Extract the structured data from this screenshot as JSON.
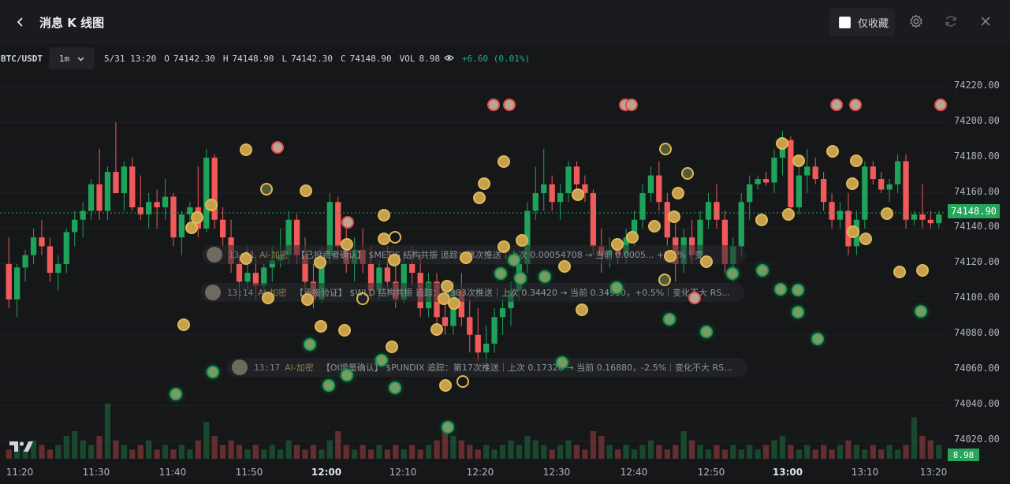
{
  "header": {
    "title": "消息 K 线图",
    "favorites_label": "仅收藏"
  },
  "ohlc": {
    "symbol": "BTC/USDT",
    "interval": "1m",
    "datetime": "5/31 13:20",
    "open_label": "O",
    "open": "74142.30",
    "high_label": "H",
    "high": "74148.90",
    "low_label": "L",
    "low": "74142.30",
    "close_label": "C",
    "close": "74148.90",
    "vol_label": "VOL",
    "vol": "8.98",
    "change": "+6.60 (0.01%)"
  },
  "price_axis": [
    "74220.00",
    "74200.00",
    "74180.00",
    "74160.00",
    "74140.00",
    "74120.00",
    "74100.00",
    "74080.00",
    "74060.00",
    "74040.00",
    "74020.00"
  ],
  "current_price": "74148.90",
  "current_volume": "8.98",
  "time_axis": [
    {
      "label": "11:20",
      "bold": false
    },
    {
      "label": "11:30",
      "bold": false
    },
    {
      "label": "11:40",
      "bold": false
    },
    {
      "label": "11:50",
      "bold": false
    },
    {
      "label": "12:00",
      "bold": true
    },
    {
      "label": "12:10",
      "bold": false
    },
    {
      "label": "12:20",
      "bold": false
    },
    {
      "label": "12:30",
      "bold": false
    },
    {
      "label": "12:40",
      "bold": false
    },
    {
      "label": "12:50",
      "bold": false
    },
    {
      "label": "13:00",
      "bold": true
    },
    {
      "label": "13:10",
      "bold": false
    },
    {
      "label": "13:20",
      "bold": false
    }
  ],
  "messages": [
    {
      "time": "13:11",
      "tag": "AI-加密",
      "text": "【已投资者确认】 $METIS 结构共振 追踪：第次推送｜上次 0.00054708 → 当前 0.0005... +2.1%｜变..."
    },
    {
      "time": "13:14",
      "tag": "AI-加密",
      "text": "【承接验证】 $WLD 结构共振 追踪：第383次推送｜上次 0.34420 → 当前 0.34930，+0.5%｜变化不大 RS..."
    },
    {
      "time": "13:17",
      "tag": "AI-加密",
      "text": "【OI增量确认】 $PUNDIX 追踪：第17次推送｜上次 0.17320 → 当前 0.16880，-2.5%｜变化不大 RS..."
    }
  ],
  "chart_data": {
    "type": "candlestick",
    "symbol": "BTC/USDT",
    "interval": "1m",
    "ylim": [
      74010,
      74225
    ],
    "x_start": "11:19",
    "x_end": "13:20",
    "candles": [
      [
        74120,
        74135,
        74095,
        74100
      ],
      [
        74100,
        74120,
        74090,
        74118
      ],
      [
        74118,
        74128,
        74110,
        74125
      ],
      [
        74125,
        74140,
        74120,
        74135
      ],
      [
        74135,
        74145,
        74125,
        74130
      ],
      [
        74130,
        74135,
        74110,
        74115
      ],
      [
        74115,
        74125,
        74105,
        74120
      ],
      [
        74120,
        74140,
        74115,
        74138
      ],
      [
        74138,
        74150,
        74130,
        74145
      ],
      [
        74145,
        74155,
        74135,
        74150
      ],
      [
        74150,
        74168,
        74145,
        74165
      ],
      [
        74165,
        74185,
        74145,
        74150
      ],
      [
        74150,
        74175,
        74145,
        74172
      ],
      [
        74172,
        74200,
        74160,
        74160
      ],
      [
        74160,
        74178,
        74150,
        74175
      ],
      [
        74175,
        74180,
        74150,
        74152
      ],
      [
        74152,
        74170,
        74145,
        74148
      ],
      [
        74148,
        74160,
        74140,
        74155
      ],
      [
        74155,
        74162,
        74140,
        74152
      ],
      [
        74152,
        74168,
        74145,
        74158
      ],
      [
        74158,
        74160,
        74130,
        74135
      ],
      [
        74135,
        74150,
        74125,
        74148
      ],
      [
        74148,
        74155,
        74140,
        74152
      ],
      [
        74152,
        74175,
        74135,
        74140
      ],
      [
        74140,
        74185,
        74138,
        74180
      ],
      [
        74180,
        74182,
        74140,
        74145
      ],
      [
        74145,
        74152,
        74130,
        74135
      ],
      [
        74135,
        74145,
        74115,
        74120
      ],
      [
        74120,
        74125,
        74100,
        74110
      ],
      [
        74110,
        74130,
        74105,
        74115
      ],
      [
        74115,
        74125,
        74100,
        74108
      ],
      [
        74108,
        74120,
        74102,
        74118
      ],
      [
        74118,
        74130,
        74110,
        74122
      ],
      [
        74122,
        74140,
        74118,
        74125
      ],
      [
        74125,
        74150,
        74120,
        74145
      ],
      [
        74145,
        74148,
        74120,
        74125
      ],
      [
        74125,
        74135,
        74105,
        74110
      ],
      [
        74110,
        74120,
        74095,
        74100
      ],
      [
        74100,
        74130,
        74098,
        74125
      ],
      [
        74125,
        74160,
        74120,
        74155
      ],
      [
        74155,
        74158,
        74125,
        74130
      ],
      [
        74130,
        74140,
        74115,
        74120
      ],
      [
        74120,
        74135,
        74110,
        74128
      ],
      [
        74128,
        74140,
        74115,
        74120
      ],
      [
        74120,
        74130,
        74100,
        74105
      ],
      [
        74105,
        74122,
        74100,
        74118
      ],
      [
        74118,
        74130,
        74105,
        74110
      ],
      [
        74110,
        74120,
        74095,
        74100
      ],
      [
        74100,
        74125,
        74098,
        74120
      ],
      [
        74120,
        74130,
        74108,
        74115
      ],
      [
        74115,
        74125,
        74090,
        74095
      ],
      [
        74095,
        74115,
        74090,
        74110
      ],
      [
        74110,
        74115,
        74085,
        74090
      ],
      [
        74090,
        74100,
        74080,
        74085
      ],
      [
        74085,
        74110,
        74080,
        74105
      ],
      [
        74105,
        74115,
        74085,
        74090
      ],
      [
        74090,
        74100,
        74070,
        74080
      ],
      [
        74080,
        74095,
        74065,
        74070
      ],
      [
        74070,
        74085,
        74060,
        74075
      ],
      [
        74075,
        74095,
        74070,
        74090
      ],
      [
        74090,
        74100,
        74080,
        74095
      ],
      [
        74095,
        74110,
        74085,
        74105
      ],
      [
        74105,
        74125,
        74100,
        74120
      ],
      [
        74120,
        74155,
        74115,
        74150
      ],
      [
        74150,
        74175,
        74145,
        74160
      ],
      [
        74160,
        74185,
        74150,
        74165
      ],
      [
        74165,
        74170,
        74150,
        74155
      ],
      [
        74155,
        74165,
        74145,
        74160
      ],
      [
        74160,
        74178,
        74155,
        74175
      ],
      [
        74175,
        74178,
        74160,
        74165
      ],
      [
        74165,
        74170,
        74155,
        74160
      ],
      [
        74160,
        74162,
        74125,
        74130
      ],
      [
        74130,
        74140,
        74115,
        74125
      ],
      [
        74125,
        74135,
        74118,
        74128
      ],
      [
        74128,
        74132,
        74120,
        74125
      ],
      [
        74125,
        74140,
        74120,
        74135
      ],
      [
        74135,
        74150,
        74130,
        74145
      ],
      [
        74145,
        74165,
        74140,
        74160
      ],
      [
        74160,
        74175,
        74155,
        74170
      ],
      [
        74170,
        74178,
        74150,
        74155
      ],
      [
        74155,
        74160,
        74130,
        74135
      ],
      [
        74135,
        74145,
        74110,
        74120
      ],
      [
        74120,
        74140,
        74115,
        74135
      ],
      [
        74135,
        74145,
        74120,
        74125
      ],
      [
        74125,
        74150,
        74120,
        74145
      ],
      [
        74145,
        74160,
        74140,
        74155
      ],
      [
        74155,
        74165,
        74140,
        74145
      ],
      [
        74145,
        74150,
        74115,
        74120
      ],
      [
        74120,
        74135,
        74110,
        74130
      ],
      [
        74130,
        74160,
        74125,
        74155
      ],
      [
        74155,
        74170,
        74145,
        74165
      ],
      [
        74165,
        74170,
        74162,
        74168
      ],
      [
        74168,
        74172,
        74164,
        74166
      ],
      [
        74166,
        74185,
        74160,
        74180
      ],
      [
        74180,
        74195,
        74170,
        74190
      ],
      [
        74190,
        74192,
        74150,
        74152
      ],
      [
        74152,
        74175,
        74148,
        74170
      ],
      [
        74170,
        74185,
        74160,
        74175
      ],
      [
        74175,
        74180,
        74165,
        74168
      ],
      [
        74168,
        74172,
        74150,
        74155
      ],
      [
        74155,
        74160,
        74140,
        74145
      ],
      [
        74145,
        74155,
        74140,
        74150
      ],
      [
        74150,
        74160,
        74125,
        74130
      ],
      [
        74130,
        74150,
        74125,
        74145
      ],
      [
        74145,
        74178,
        74140,
        74175
      ],
      [
        74175,
        74178,
        74165,
        74168
      ],
      [
        74168,
        74172,
        74160,
        74162
      ],
      [
        74162,
        74168,
        74155,
        74165
      ],
      [
        74165,
        74182,
        74160,
        74178
      ],
      [
        74178,
        74182,
        74140,
        74145
      ],
      [
        74145,
        74150,
        74142,
        74148
      ],
      [
        74148,
        74165,
        74140,
        74145
      ],
      [
        74145,
        74150,
        74140,
        74143
      ],
      [
        74143,
        74150,
        74140,
        74148
      ]
    ],
    "volumes": [
      2,
      3,
      2,
      4,
      3,
      2,
      3,
      5,
      6,
      4,
      3,
      5,
      12,
      4,
      3,
      2,
      3,
      4,
      2,
      3,
      2,
      3,
      2,
      4,
      8,
      5,
      3,
      4,
      3,
      2,
      3,
      2,
      3,
      2,
      4,
      3,
      2,
      3,
      2,
      4,
      6,
      3,
      2,
      3,
      2,
      3,
      2,
      3,
      2,
      3,
      2,
      3,
      4,
      6,
      5,
      4,
      3,
      2,
      3,
      2,
      3,
      4,
      3,
      5,
      4,
      3,
      2,
      3,
      4,
      3,
      2,
      6,
      5,
      3,
      2,
      3,
      2,
      3,
      4,
      3,
      2,
      3,
      6,
      4,
      3,
      2,
      3,
      2,
      3,
      2,
      3,
      2,
      3,
      4,
      5,
      3,
      2,
      3,
      2,
      3,
      2,
      3,
      4,
      3,
      2,
      3,
      2,
      3,
      2,
      3,
      9,
      5,
      4,
      3,
      3
    ]
  }
}
